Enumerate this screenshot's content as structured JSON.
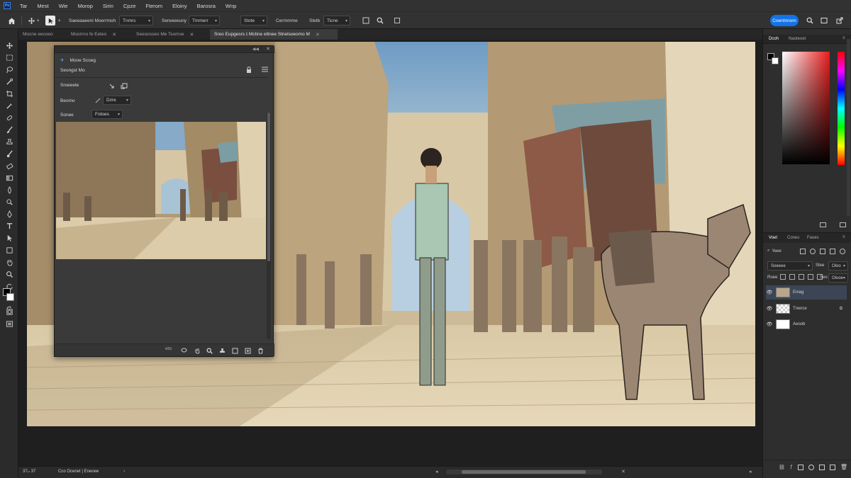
{
  "menubar": {
    "items": [
      "Tar",
      "Mest",
      "Wie",
      "Morop",
      "Sirin",
      "Cpze",
      "Fterom",
      "Eloiny",
      "Barosra",
      "Wnp"
    ]
  },
  "options": {
    "label1": "Saeeaaeeni Moerrmoh",
    "drop1": "Tnmrs",
    "label2": "Sereeeeuny",
    "drop2": "Tmmerr",
    "drop3": "Stote",
    "label3": "Cerrnmme",
    "label4": "Stetb",
    "drop4": "Ticne",
    "share": "Coentnnom"
  },
  "tabs": [
    {
      "label": "Mocne eecoeo",
      "close": ""
    },
    {
      "label": "Moorrno fe Eeteo",
      "close": "✕"
    },
    {
      "label": "Seeoosseo Me Tsomse",
      "close": "✕"
    },
    {
      "label": "Sreo Eupgesrs ɪ Mctine ettnee Stnelsoeomo M",
      "close": "✕"
    }
  ],
  "float_panel": {
    "title": "Mooe Scoeg",
    "subtitle": "Seongst Mo",
    "row1_label": "Sroeeete",
    "row2_label": "Beomo",
    "row2_drop": "Dzre",
    "row3_label": "Sonee",
    "row3_drop": "Fotoes",
    "footer_text": "ebc"
  },
  "right_panel": {
    "tab_active": "Dcoh",
    "tab_other": "Naoteoet",
    "layers_tabs": [
      "Voet",
      "Cones",
      "Faoes"
    ],
    "layers_header": "Yeee",
    "blend_mode": "Soeeee",
    "opacity_label": "Stee",
    "opacity_value": "Oloo",
    "fill_label": "Seo",
    "fill_value": "Olooe",
    "lock_label": "Roee",
    "layers": [
      {
        "name": "Eniag",
        "selected": true
      },
      {
        "name": "Tnwrce",
        "selected": false
      },
      {
        "name": "Aeoob",
        "selected": false
      }
    ]
  },
  "status": {
    "zoom": "37ᴗ 37",
    "doc": "Cco Ocenet | Eneoee"
  },
  "colors": {
    "accent": "#1473e6",
    "chrome": "#323232",
    "panel": "#2e2e2e"
  }
}
